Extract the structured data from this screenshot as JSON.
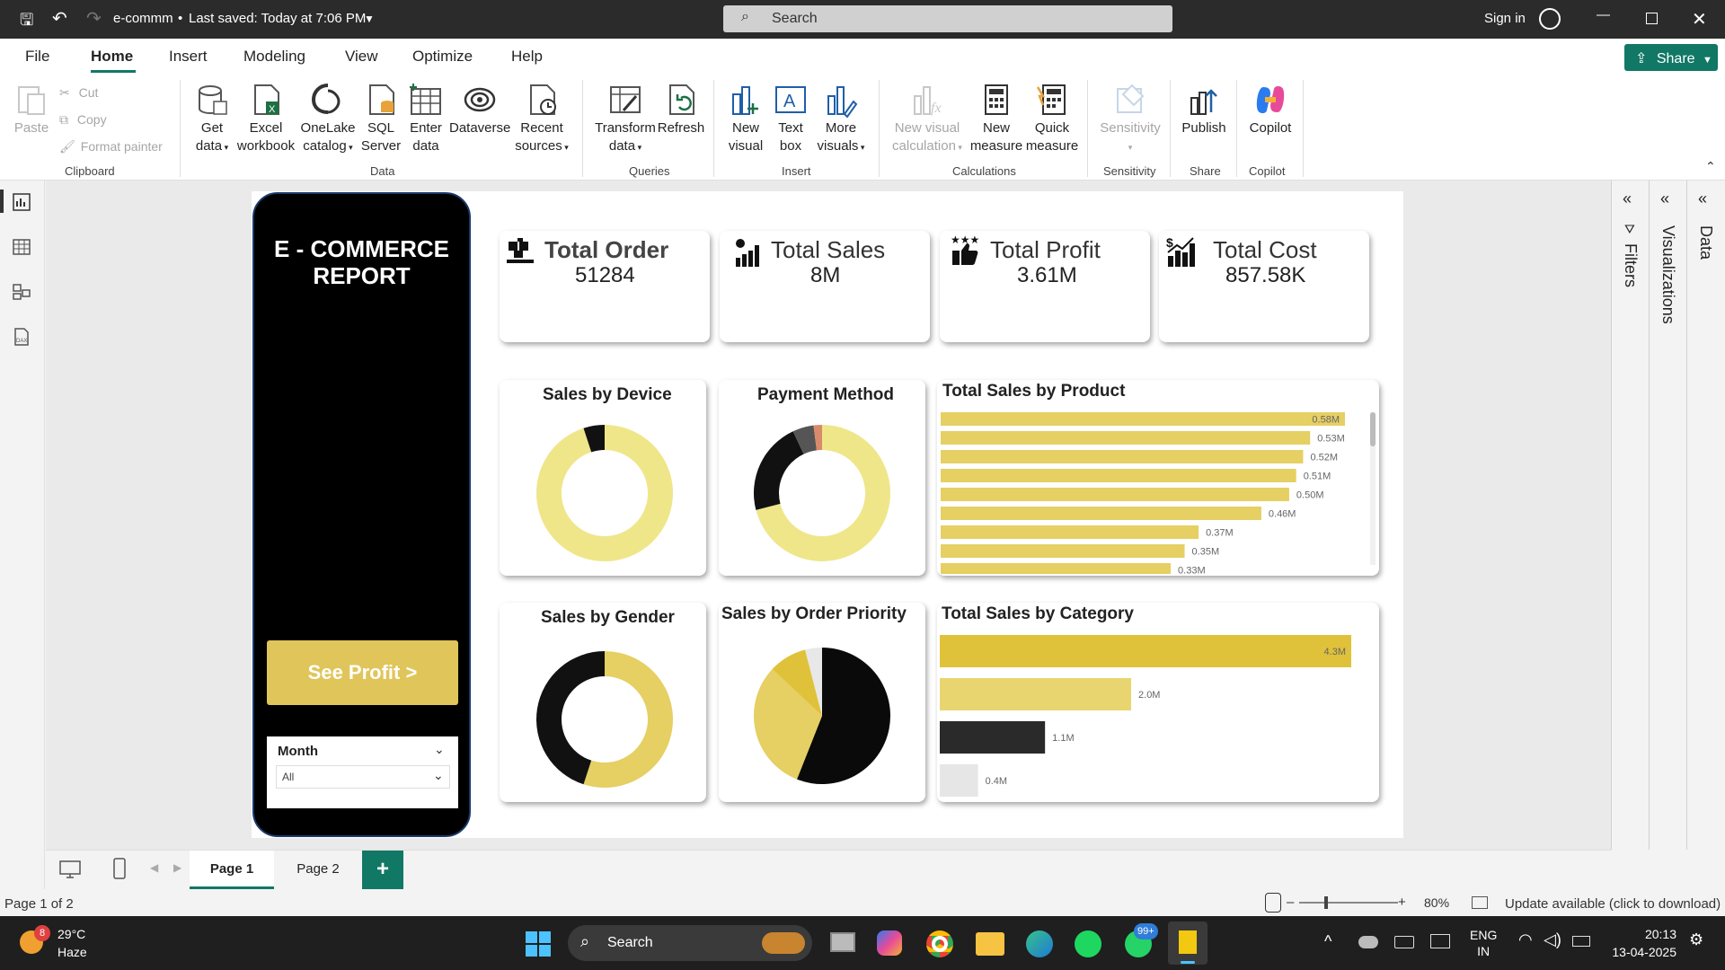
{
  "titlebar": {
    "file_name": "e-commm",
    "save_status": "Last saved: Today at 7:06 PM",
    "search_placeholder": "Search",
    "sign_in": "Sign in"
  },
  "ribbon_tabs": [
    "File",
    "Home",
    "Insert",
    "Modeling",
    "View",
    "Optimize",
    "Help"
  ],
  "share_label": "Share",
  "ribbon": {
    "clipboard": {
      "paste": "Paste",
      "cut": "Cut",
      "copy": "Copy",
      "format_painter": "Format painter",
      "group": "Clipboard"
    },
    "data": {
      "get_data": [
        "Get",
        "data"
      ],
      "excel": [
        "Excel",
        "workbook"
      ],
      "onelake": [
        "OneLake",
        "catalog"
      ],
      "sql": [
        "SQL",
        "Server"
      ],
      "enter": [
        "Enter",
        "data"
      ],
      "dataverse": "Dataverse",
      "recent": [
        "Recent",
        "sources"
      ],
      "group": "Data"
    },
    "queries": {
      "transform": [
        "Transform",
        "data"
      ],
      "refresh": "Refresh",
      "group": "Queries"
    },
    "insert": {
      "new_visual": [
        "New",
        "visual"
      ],
      "text_box": [
        "Text",
        "box"
      ],
      "more_visuals": [
        "More",
        "visuals"
      ],
      "group": "Insert"
    },
    "calculations": {
      "new_visual_calc": [
        "New visual",
        "calculation"
      ],
      "new_measure": [
        "New",
        "measure"
      ],
      "quick_measure": [
        "Quick",
        "measure"
      ],
      "group": "Calculations"
    },
    "sensitivity": {
      "label": "Sensitivity",
      "group": "Sensitivity"
    },
    "share": {
      "publish": "Publish",
      "group": "Share"
    },
    "copilot": {
      "label": "Copilot",
      "group": "Copilot"
    }
  },
  "report": {
    "title_line1": "E - COMMERCE",
    "title_line2": "REPORT",
    "see_profit": "See Profit >",
    "slicer": {
      "label": "Month",
      "value": "All"
    },
    "kpis": [
      {
        "title": "Total Order",
        "value": "51284"
      },
      {
        "title": "Total Sales",
        "value": "8M"
      },
      {
        "title": "Total Profit",
        "value": "3.61M"
      },
      {
        "title": "Total Cost",
        "value": "857.58K"
      }
    ],
    "charts": {
      "device": "Sales by Device",
      "payment": "Payment Method",
      "product": "Total Sales by Product",
      "gender": "Sales by Gender",
      "priority": "Sales by Order Priority",
      "category": "Total Sales by Category"
    }
  },
  "chart_data": [
    {
      "type": "bar",
      "title": "Total Sales by Product",
      "orientation": "horizontal",
      "values": [
        0.58,
        0.53,
        0.52,
        0.51,
        0.5,
        0.46,
        0.37,
        0.35,
        0.33
      ],
      "labels": [
        "0.58M",
        "0.53M",
        "0.52M",
        "0.51M",
        "0.50M",
        "0.46M",
        "0.37M",
        "0.35M",
        "0.33M"
      ],
      "color": "#e6cf63"
    },
    {
      "type": "bar",
      "title": "Total Sales by Category",
      "orientation": "horizontal",
      "values": [
        4.3,
        2.0,
        1.1,
        0.4
      ],
      "labels": [
        "4.3M",
        "2.0M",
        "1.1M",
        "0.4M"
      ],
      "colors": [
        "#dfc23a",
        "#e8d56f",
        "#2a2a2a",
        "#e6e6e6"
      ]
    },
    {
      "type": "pie",
      "title": "Sales by Device",
      "donut": true,
      "values": [
        0.95,
        0.05
      ],
      "colors": [
        "#efe68a",
        "#111111"
      ]
    },
    {
      "type": "pie",
      "title": "Payment Method",
      "donut": true,
      "values": [
        0.71,
        0.22,
        0.05,
        0.02
      ],
      "colors": [
        "#efe68a",
        "#111111",
        "#555555",
        "#d98a6a"
      ]
    },
    {
      "type": "pie",
      "title": "Sales by Gender",
      "donut": true,
      "values": [
        0.55,
        0.45
      ],
      "colors": [
        "#e6cf63",
        "#111111"
      ]
    },
    {
      "type": "pie",
      "title": "Sales by Order Priority",
      "donut": false,
      "values": [
        0.56,
        0.31,
        0.09,
        0.04
      ],
      "colors": [
        "#0a0a0a",
        "#e6cf63",
        "#dfc23a",
        "#e8e8e8"
      ]
    }
  ],
  "pages": {
    "page1": "Page 1",
    "page2": "Page 2",
    "add": "+"
  },
  "statusbar": {
    "page_info": "Page 1 of 2",
    "zoom": "80%",
    "update": "Update available (click to download)"
  },
  "panes": {
    "filters": "Filters",
    "visualizations": "Visualizations",
    "data": "Data"
  },
  "taskbar": {
    "temp": "29°C",
    "weather": "Haze",
    "weather_badge": "8",
    "search": "Search",
    "lang1": "ENG",
    "lang2": "IN",
    "time": "20:13",
    "date": "13-04-2025",
    "whatsapp_badge": "99+"
  }
}
